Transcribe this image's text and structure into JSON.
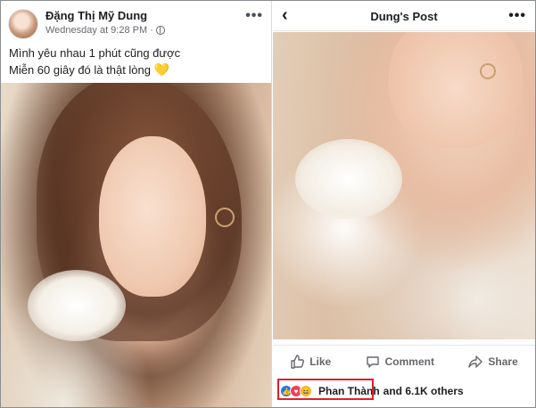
{
  "left_post": {
    "author": "Đặng Thị Mỹ Dung",
    "timestamp": "Wednesday at 9:28 PM",
    "separator": "·",
    "caption_line1": "Mình yêu nhau 1 phút cũng được",
    "caption_line2": "Miễn 60 giây đó là thật lòng",
    "caption_emoji": "💛",
    "more": "•••"
  },
  "right_post": {
    "back": "‹",
    "title": "Dung's Post",
    "more": "•••",
    "actions": {
      "like": "Like",
      "comment": "Comment",
      "share": "Share"
    },
    "reactions": {
      "icons": [
        "like-icon",
        "love-icon",
        "haha-icon"
      ],
      "reactor": "Phan Thành",
      "others": "and 6.1K others"
    }
  },
  "colors": {
    "facebook_blue": "#1877f2",
    "love_red": "#f33e58",
    "haha_yellow": "#f7b928",
    "highlight_red": "#e41e26",
    "muted_text": "#65676b"
  }
}
